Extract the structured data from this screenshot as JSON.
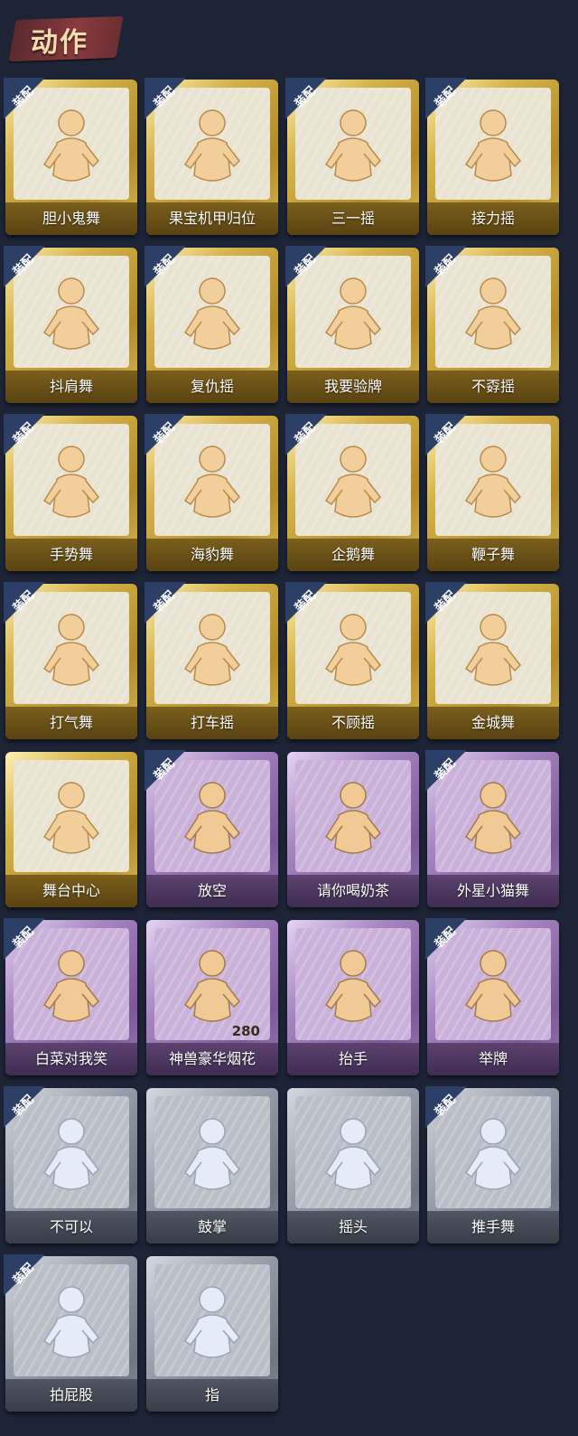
{
  "header": {
    "title": "动作"
  },
  "equip_label": "装配",
  "colors": {
    "gold": "#c9a53a",
    "purple": "#8a68a8",
    "gray": "#8d939d"
  },
  "cards": [
    {
      "name": "胆小鬼舞",
      "tier": "gold",
      "equipped": true,
      "icon": "dancer-heart-icon"
    },
    {
      "name": "果宝机甲归位",
      "tier": "gold",
      "equipped": true,
      "icon": "dancer-music-icon"
    },
    {
      "name": "三一摇",
      "tier": "gold",
      "equipped": true,
      "icon": "dancer-icon"
    },
    {
      "name": "接力摇",
      "tier": "gold",
      "equipped": true,
      "icon": "dancer-music-icon"
    },
    {
      "name": "抖肩舞",
      "tier": "gold",
      "equipped": true,
      "icon": "dancer-star-icon"
    },
    {
      "name": "复仇摇",
      "tier": "gold",
      "equipped": true,
      "icon": "dancer-point-up-icon"
    },
    {
      "name": "我要验牌",
      "tier": "gold",
      "equipped": true,
      "icon": "dancer-card-icon"
    },
    {
      "name": "不孬摇",
      "tier": "gold",
      "equipped": true,
      "icon": "dancer-arm-up-icon"
    },
    {
      "name": "手势舞",
      "tier": "gold",
      "equipped": true,
      "icon": "dancer-music-icon"
    },
    {
      "name": "海豹舞",
      "tier": "gold",
      "equipped": true,
      "icon": "dancer-music-icon"
    },
    {
      "name": "企鹅舞",
      "tier": "gold",
      "equipped": true,
      "icon": "dancer-icon"
    },
    {
      "name": "鞭子舞",
      "tier": "gold",
      "equipped": true,
      "icon": "dancer-heart-icon"
    },
    {
      "name": "打气舞",
      "tier": "gold",
      "equipped": true,
      "icon": "dancer-music-icon"
    },
    {
      "name": "打车摇",
      "tier": "gold",
      "equipped": true,
      "icon": "dancer-music-icon"
    },
    {
      "name": "不顾摇",
      "tier": "gold",
      "equipped": true,
      "icon": "dancer-point-icon"
    },
    {
      "name": "金城舞",
      "tier": "gold",
      "equipped": true,
      "icon": "dancer-music-icon"
    },
    {
      "name": "舞台中心",
      "tier": "gold",
      "equipped": false,
      "icon": "dancer-icon"
    },
    {
      "name": "放空",
      "tier": "purple",
      "equipped": true,
      "icon": "hooded-figure-icon"
    },
    {
      "name": "请你喝奶茶",
      "tier": "purple",
      "equipped": false,
      "icon": "figure-sign-icon"
    },
    {
      "name": "外星小猫舞",
      "tier": "purple",
      "equipped": true,
      "icon": "dancer-icon"
    },
    {
      "name": "白菜对我笑",
      "tier": "purple",
      "equipped": true,
      "icon": "dancer-icon"
    },
    {
      "name": "神兽豪华烟花",
      "tier": "purple",
      "equipped": false,
      "icon": "fireworks-icon",
      "count": "280"
    },
    {
      "name": "抬手",
      "tier": "purple",
      "equipped": false,
      "icon": "figure-raise-hand-icon"
    },
    {
      "name": "举牌",
      "tier": "purple",
      "equipped": true,
      "icon": "figure-sign-icon"
    },
    {
      "name": "不可以",
      "tier": "gray",
      "equipped": true,
      "icon": "finger-wag-icon"
    },
    {
      "name": "鼓掌",
      "tier": "gray",
      "equipped": false,
      "icon": "clap-icon"
    },
    {
      "name": "摇头",
      "tier": "gray",
      "equipped": false,
      "icon": "head-shake-icon"
    },
    {
      "name": "推手舞",
      "tier": "gray",
      "equipped": true,
      "icon": "push-hands-icon"
    },
    {
      "name": "拍屁股",
      "tier": "gray",
      "equipped": true,
      "icon": "figure-icon"
    },
    {
      "name": "指",
      "tier": "gray",
      "equipped": false,
      "icon": "point-icon"
    }
  ]
}
